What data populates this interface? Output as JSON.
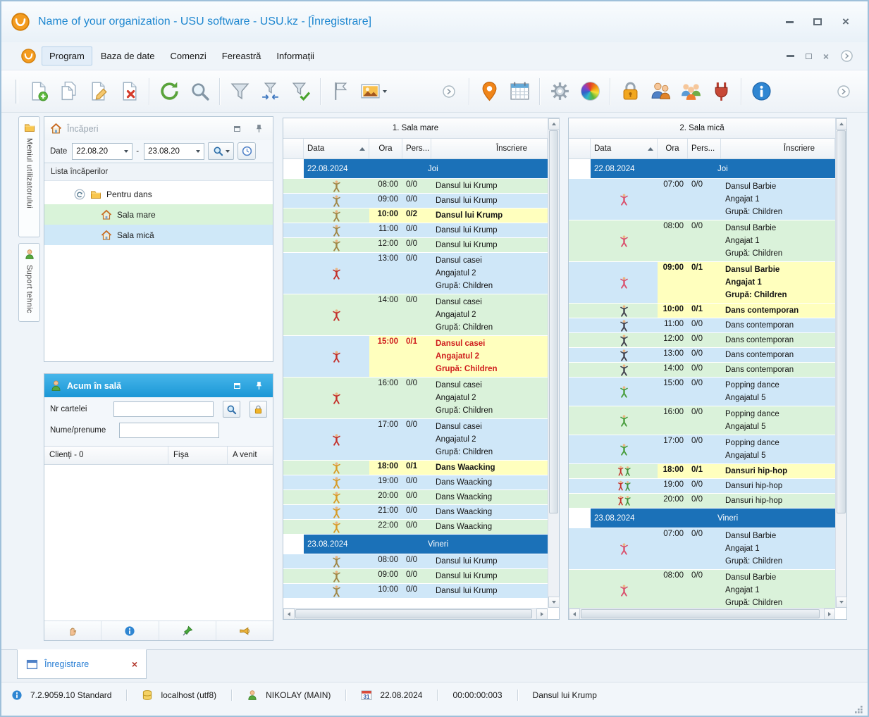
{
  "colors": {
    "title_blue": "#1e87d0",
    "panel_header_blue": "#29a3df",
    "date_band_blue": "#1b71b8",
    "row_green": "#daf2da",
    "row_blue": "#cfe7f8",
    "highlight_yellow": "#ffffbe",
    "alert_red": "#cf1d1d",
    "selection_green": "#d9f3d9",
    "selection_blue": "#cfe8f8"
  },
  "window": {
    "title": "Name of your organization - USU software - USU.kz - [Înregistrare]"
  },
  "menu": [
    "Program",
    "Baza de date",
    "Comenzi",
    "Fereastră",
    "Informații"
  ],
  "toolbar": {
    "buttons": [
      {
        "icon": "doc-new"
      },
      {
        "icon": "doc-copy"
      },
      {
        "icon": "doc-edit"
      },
      {
        "icon": "doc-delete"
      },
      {
        "sep": true
      },
      {
        "icon": "refresh"
      },
      {
        "icon": "search"
      },
      {
        "sep": true
      },
      {
        "icon": "filter"
      },
      {
        "icon": "filter-arrows"
      },
      {
        "icon": "filter-check"
      },
      {
        "sep": true
      },
      {
        "icon": "flag"
      },
      {
        "icon": "picture",
        "dropdown": true
      },
      {
        "gap": 58
      },
      {
        "icon": "nav-circle",
        "small": true
      },
      {
        "sep": true
      },
      {
        "icon": "location-pin"
      },
      {
        "icon": "calendar"
      },
      {
        "sep": true
      },
      {
        "icon": "gear"
      },
      {
        "icon": "palette"
      },
      {
        "sep": true
      },
      {
        "icon": "lock"
      },
      {
        "icon": "user-pair"
      },
      {
        "icon": "user-group"
      },
      {
        "icon": "plug"
      },
      {
        "sep": true
      },
      {
        "icon": "info"
      },
      {
        "icon": "nav-circle",
        "small": true,
        "right": true
      }
    ]
  },
  "side_tabs": [
    {
      "label": "Meniul utilizatorului",
      "icon": "folder"
    },
    {
      "label": "Suport tehnic",
      "icon": "person-green"
    }
  ],
  "rooms_panel": {
    "title": "Încăperi",
    "date_label": "Date",
    "date_from": "22.08.20",
    "date_to": "23.08.20",
    "separator": "-",
    "list_header": "Lista încăperilor",
    "folder_label": "Pentru dans",
    "rooms": [
      {
        "label": "Sala mare"
      },
      {
        "label": "Sala mică"
      }
    ]
  },
  "now_panel": {
    "title": "Acum în sală",
    "card_label": "Nr cartelei",
    "name_label": "Nume/prenume",
    "columns": [
      "Clienți - 0",
      "Fişa",
      "A venit"
    ]
  },
  "schedules": [
    {
      "title": "1. Sala mare",
      "columns": {
        "data": "Data",
        "ora": "Ora",
        "pers": "Pers...",
        "inscriere": "Înscriere"
      },
      "rows": [
        {
          "type": "date",
          "date": "22.08.2024",
          "day": "Joi"
        },
        {
          "type": "slot",
          "time": "08:00",
          "pers": "0/0",
          "lines": [
            "Dansul lui Krump"
          ],
          "icon": "krump",
          "bg": "g"
        },
        {
          "type": "slot",
          "time": "09:00",
          "pers": "0/0",
          "lines": [
            "Dansul lui Krump"
          ],
          "icon": "krump",
          "bg": "b"
        },
        {
          "type": "slot",
          "time": "10:00",
          "pers": "0/2",
          "lines": [
            "Dansul lui Krump"
          ],
          "icon": "krump",
          "bg": "g",
          "hl": true
        },
        {
          "type": "slot",
          "time": "11:00",
          "pers": "0/0",
          "lines": [
            "Dansul lui Krump"
          ],
          "icon": "krump",
          "bg": "b"
        },
        {
          "type": "slot",
          "time": "12:00",
          "pers": "0/0",
          "lines": [
            "Dansul lui Krump"
          ],
          "icon": "krump",
          "bg": "g"
        },
        {
          "type": "slot",
          "time": "13:00",
          "pers": "0/0",
          "lines": [
            "Dansul casei",
            "Angajatul 2",
            "Grupă: Children"
          ],
          "icon": "casei",
          "bg": "b"
        },
        {
          "type": "slot",
          "time": "14:00",
          "pers": "0/0",
          "lines": [
            "Dansul casei",
            "Angajatul 2",
            "Grupă: Children"
          ],
          "icon": "casei",
          "bg": "g"
        },
        {
          "type": "slot",
          "time": "15:00",
          "pers": "0/1",
          "lines": [
            "Dansul casei",
            "Angajatul 2",
            "Grupă: Children"
          ],
          "icon": "casei",
          "bg": "b",
          "hl": true,
          "red": true
        },
        {
          "type": "slot",
          "time": "16:00",
          "pers": "0/0",
          "lines": [
            "Dansul casei",
            "Angajatul 2",
            "Grupă: Children"
          ],
          "icon": "casei",
          "bg": "g"
        },
        {
          "type": "slot",
          "time": "17:00",
          "pers": "0/0",
          "lines": [
            "Dansul casei",
            "Angajatul 2",
            "Grupă: Children"
          ],
          "icon": "casei",
          "bg": "b"
        },
        {
          "type": "slot",
          "time": "18:00",
          "pers": "0/1",
          "lines": [
            "Dans Waacking"
          ],
          "icon": "waacking",
          "bg": "g",
          "hl": true
        },
        {
          "type": "slot",
          "time": "19:00",
          "pers": "0/0",
          "lines": [
            "Dans Waacking"
          ],
          "icon": "waacking",
          "bg": "b"
        },
        {
          "type": "slot",
          "time": "20:00",
          "pers": "0/0",
          "lines": [
            "Dans Waacking"
          ],
          "icon": "waacking",
          "bg": "g"
        },
        {
          "type": "slot",
          "time": "21:00",
          "pers": "0/0",
          "lines": [
            "Dans Waacking"
          ],
          "icon": "waacking",
          "bg": "b"
        },
        {
          "type": "slot",
          "time": "22:00",
          "pers": "0/0",
          "lines": [
            "Dans Waacking"
          ],
          "icon": "waacking",
          "bg": "g"
        },
        {
          "type": "date",
          "date": "23.08.2024",
          "day": "Vineri"
        },
        {
          "type": "slot",
          "time": "08:00",
          "pers": "0/0",
          "lines": [
            "Dansul lui Krump"
          ],
          "icon": "krump",
          "bg": "b"
        },
        {
          "type": "slot",
          "time": "09:00",
          "pers": "0/0",
          "lines": [
            "Dansul lui Krump"
          ],
          "icon": "krump",
          "bg": "g"
        },
        {
          "type": "slot",
          "time": "10:00",
          "pers": "0/0",
          "lines": [
            "Dansul lui Krump"
          ],
          "icon": "krump",
          "bg": "b"
        }
      ]
    },
    {
      "title": "2. Sala mică",
      "columns": {
        "data": "Data",
        "ora": "Ora",
        "pers": "Pers...",
        "inscriere": "Înscriere"
      },
      "rows": [
        {
          "type": "date",
          "date": "22.08.2024",
          "day": "Joi"
        },
        {
          "type": "slot",
          "time": "07:00",
          "pers": "0/0",
          "lines": [
            "Dansul Barbie",
            "Angajat 1",
            "Grupă: Children"
          ],
          "icon": "barbie",
          "bg": "b"
        },
        {
          "type": "slot",
          "time": "08:00",
          "pers": "0/0",
          "lines": [
            "Dansul Barbie",
            "Angajat 1",
            "Grupă: Children"
          ],
          "icon": "barbie",
          "bg": "g"
        },
        {
          "type": "slot",
          "time": "09:00",
          "pers": "0/1",
          "lines": [
            "Dansul Barbie",
            "Angajat 1",
            "Grupă: Children"
          ],
          "icon": "barbie",
          "bg": "b",
          "hl": true
        },
        {
          "type": "slot",
          "time": "10:00",
          "pers": "0/1",
          "lines": [
            "Dans contemporan"
          ],
          "icon": "contemporan",
          "bg": "g",
          "hl": true
        },
        {
          "type": "slot",
          "time": "11:00",
          "pers": "0/0",
          "lines": [
            "Dans contemporan"
          ],
          "icon": "contemporan",
          "bg": "b"
        },
        {
          "type": "slot",
          "time": "12:00",
          "pers": "0/0",
          "lines": [
            "Dans contemporan"
          ],
          "icon": "contemporan",
          "bg": "g"
        },
        {
          "type": "slot",
          "time": "13:00",
          "pers": "0/0",
          "lines": [
            "Dans contemporan"
          ],
          "icon": "contemporan",
          "bg": "b"
        },
        {
          "type": "slot",
          "time": "14:00",
          "pers": "0/0",
          "lines": [
            "Dans contemporan"
          ],
          "icon": "contemporan",
          "bg": "g"
        },
        {
          "type": "slot",
          "time": "15:00",
          "pers": "0/0",
          "lines": [
            "Popping dance",
            "Angajatul 5"
          ],
          "icon": "popping",
          "bg": "b"
        },
        {
          "type": "slot",
          "time": "16:00",
          "pers": "0/0",
          "lines": [
            "Popping dance",
            "Angajatul 5"
          ],
          "icon": "popping",
          "bg": "g"
        },
        {
          "type": "slot",
          "time": "17:00",
          "pers": "0/0",
          "lines": [
            "Popping dance",
            "Angajatul 5"
          ],
          "icon": "popping",
          "bg": "b"
        },
        {
          "type": "slot",
          "time": "18:00",
          "pers": "0/1",
          "lines": [
            "Dansuri hip-hop"
          ],
          "icon": "hiphop",
          "bg": "g",
          "hl": true
        },
        {
          "type": "slot",
          "time": "19:00",
          "pers": "0/0",
          "lines": [
            "Dansuri hip-hop"
          ],
          "icon": "hiphop",
          "bg": "b"
        },
        {
          "type": "slot",
          "time": "20:00",
          "pers": "0/0",
          "lines": [
            "Dansuri hip-hop"
          ],
          "icon": "hiphop",
          "bg": "g"
        },
        {
          "type": "date",
          "date": "23.08.2024",
          "day": "Vineri"
        },
        {
          "type": "slot",
          "time": "07:00",
          "pers": "0/0",
          "lines": [
            "Dansul Barbie",
            "Angajat 1",
            "Grupă: Children"
          ],
          "icon": "barbie",
          "bg": "b"
        },
        {
          "type": "slot",
          "time": "08:00",
          "pers": "0/0",
          "lines": [
            "Dansul Barbie",
            "Angajat 1",
            "Grupă: Children"
          ],
          "icon": "barbie",
          "bg": "g"
        }
      ]
    }
  ],
  "bottom_tab": {
    "label": "Înregistrare"
  },
  "status_bar": {
    "version": "7.2.9059.10 Standard",
    "database": "localhost (utf8)",
    "user": "NIKOLAY (MAIN)",
    "date": "22.08.2024",
    "timer": "00:00:00:003",
    "current_item": "Dansul lui Krump"
  }
}
